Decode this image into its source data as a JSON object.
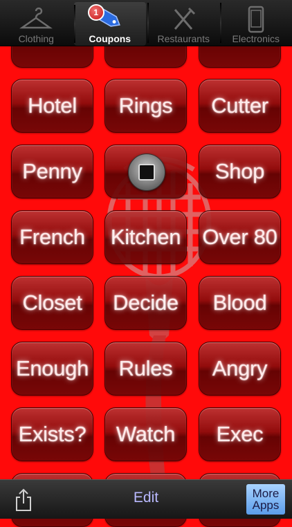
{
  "tabs": [
    {
      "label": "Clothing",
      "icon": "hanger-icon",
      "active": false
    },
    {
      "label": "Coupons",
      "icon": "tag-icon",
      "active": true,
      "badge": "1"
    },
    {
      "label": "Restaurants",
      "icon": "fork-knife-icon",
      "active": false
    },
    {
      "label": "Electronics",
      "icon": "phone-icon",
      "active": false
    }
  ],
  "rows": [
    [
      "",
      "",
      ""
    ],
    [
      "Hotel",
      "Rings",
      "Cutter"
    ],
    [
      "Penny",
      "",
      "Shop"
    ],
    [
      "French",
      "Kitchen",
      "Over 80"
    ],
    [
      "Closet",
      "Decide",
      "Blood"
    ],
    [
      "Enough",
      "Rules",
      "Angry"
    ],
    [
      "Exists?",
      "Watch",
      "Exec"
    ]
  ],
  "toolbar": {
    "edit_label": "Edit",
    "more_line1": "More",
    "more_line2": "Apps"
  },
  "colors": {
    "background": "#ff0a0a",
    "button": "#8a0d0d",
    "edit_text": "#b9b9ff",
    "more_apps_bg": "#7db7f4"
  }
}
